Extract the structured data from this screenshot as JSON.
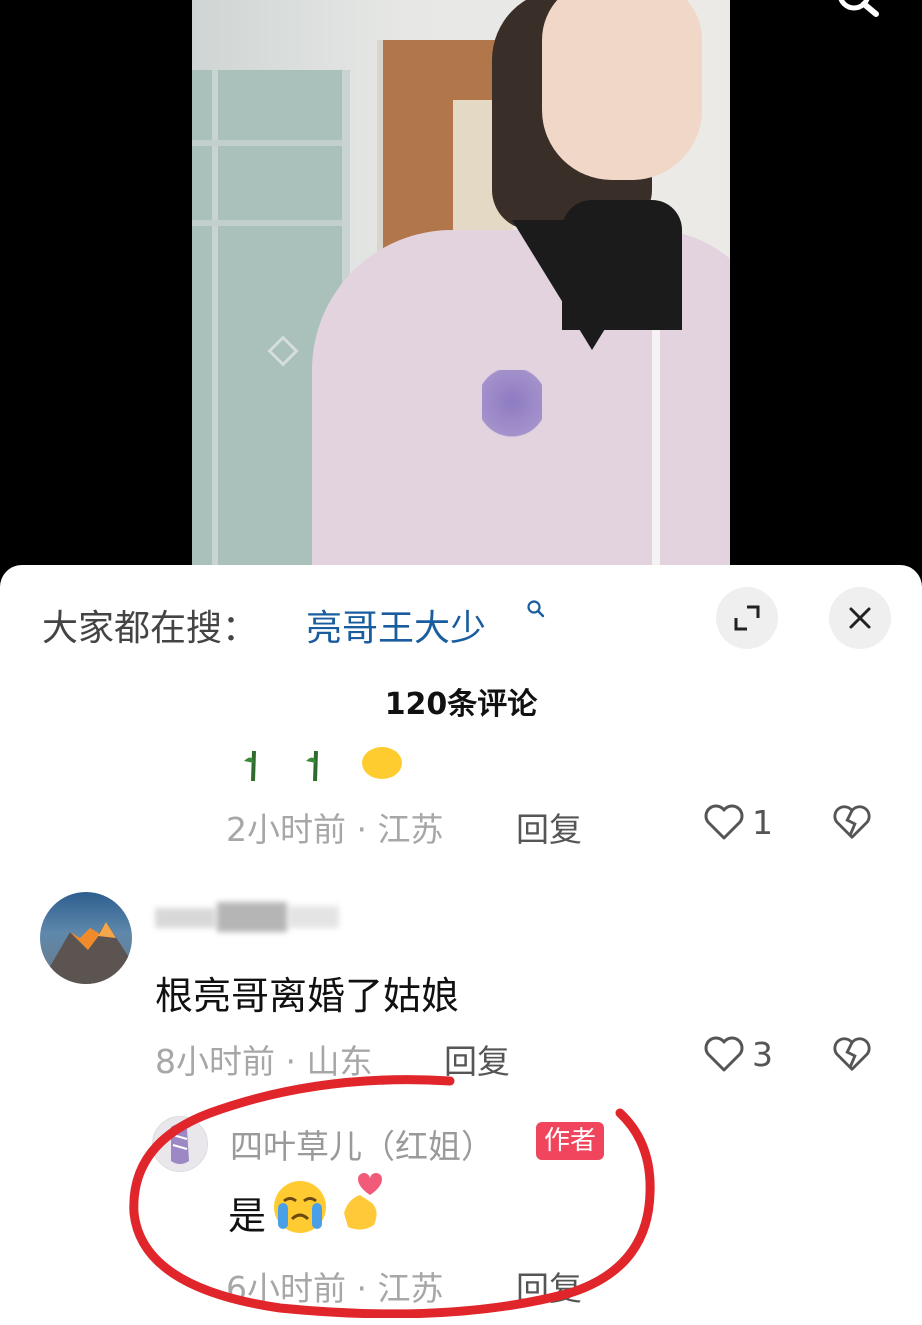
{
  "video": {
    "search_icon": "search-icon"
  },
  "panel": {
    "hot_search_label": "大家都在搜：",
    "hot_search_term": "亮哥王大少",
    "comments_count": "120条评论"
  },
  "comments": [
    {
      "emoji": [
        "rose-emoji",
        "rose-emoji",
        "hand-emoji"
      ],
      "time": "2小时前 · 江苏",
      "reply_label": "回复",
      "likes": "1"
    },
    {
      "avatar": "mountain-avatar",
      "text": "根亮哥离婚了姑娘",
      "time": "8小时前 · 山东",
      "reply_label": "回复",
      "likes": "3",
      "replies": [
        {
          "author": "四叶草儿（红姐）",
          "badge": "作者",
          "text": "是",
          "emoji": [
            "crying-emoji",
            "finger-heart-emoji"
          ],
          "time": "6小时前 · 江苏",
          "reply_label": "回复"
        }
      ]
    }
  ],
  "colors": {
    "link": "#1a5d9e",
    "badge": "#f0455c",
    "annotation": "#e0262b"
  }
}
